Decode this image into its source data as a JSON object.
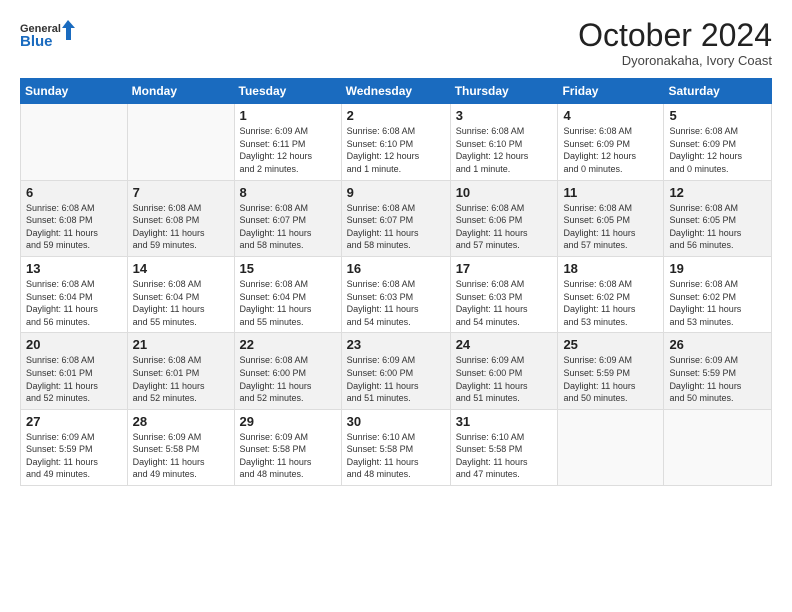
{
  "header": {
    "logo_general": "General",
    "logo_blue": "Blue",
    "month": "October 2024",
    "location": "Dyoronakaha, Ivory Coast"
  },
  "weekdays": [
    "Sunday",
    "Monday",
    "Tuesday",
    "Wednesday",
    "Thursday",
    "Friday",
    "Saturday"
  ],
  "weeks": [
    [
      {
        "day": "",
        "info": ""
      },
      {
        "day": "",
        "info": ""
      },
      {
        "day": "1",
        "info": "Sunrise: 6:09 AM\nSunset: 6:11 PM\nDaylight: 12 hours\nand 2 minutes."
      },
      {
        "day": "2",
        "info": "Sunrise: 6:08 AM\nSunset: 6:10 PM\nDaylight: 12 hours\nand 1 minute."
      },
      {
        "day": "3",
        "info": "Sunrise: 6:08 AM\nSunset: 6:10 PM\nDaylight: 12 hours\nand 1 minute."
      },
      {
        "day": "4",
        "info": "Sunrise: 6:08 AM\nSunset: 6:09 PM\nDaylight: 12 hours\nand 0 minutes."
      },
      {
        "day": "5",
        "info": "Sunrise: 6:08 AM\nSunset: 6:09 PM\nDaylight: 12 hours\nand 0 minutes."
      }
    ],
    [
      {
        "day": "6",
        "info": "Sunrise: 6:08 AM\nSunset: 6:08 PM\nDaylight: 11 hours\nand 59 minutes."
      },
      {
        "day": "7",
        "info": "Sunrise: 6:08 AM\nSunset: 6:08 PM\nDaylight: 11 hours\nand 59 minutes."
      },
      {
        "day": "8",
        "info": "Sunrise: 6:08 AM\nSunset: 6:07 PM\nDaylight: 11 hours\nand 58 minutes."
      },
      {
        "day": "9",
        "info": "Sunrise: 6:08 AM\nSunset: 6:07 PM\nDaylight: 11 hours\nand 58 minutes."
      },
      {
        "day": "10",
        "info": "Sunrise: 6:08 AM\nSunset: 6:06 PM\nDaylight: 11 hours\nand 57 minutes."
      },
      {
        "day": "11",
        "info": "Sunrise: 6:08 AM\nSunset: 6:05 PM\nDaylight: 11 hours\nand 57 minutes."
      },
      {
        "day": "12",
        "info": "Sunrise: 6:08 AM\nSunset: 6:05 PM\nDaylight: 11 hours\nand 56 minutes."
      }
    ],
    [
      {
        "day": "13",
        "info": "Sunrise: 6:08 AM\nSunset: 6:04 PM\nDaylight: 11 hours\nand 56 minutes."
      },
      {
        "day": "14",
        "info": "Sunrise: 6:08 AM\nSunset: 6:04 PM\nDaylight: 11 hours\nand 55 minutes."
      },
      {
        "day": "15",
        "info": "Sunrise: 6:08 AM\nSunset: 6:04 PM\nDaylight: 11 hours\nand 55 minutes."
      },
      {
        "day": "16",
        "info": "Sunrise: 6:08 AM\nSunset: 6:03 PM\nDaylight: 11 hours\nand 54 minutes."
      },
      {
        "day": "17",
        "info": "Sunrise: 6:08 AM\nSunset: 6:03 PM\nDaylight: 11 hours\nand 54 minutes."
      },
      {
        "day": "18",
        "info": "Sunrise: 6:08 AM\nSunset: 6:02 PM\nDaylight: 11 hours\nand 53 minutes."
      },
      {
        "day": "19",
        "info": "Sunrise: 6:08 AM\nSunset: 6:02 PM\nDaylight: 11 hours\nand 53 minutes."
      }
    ],
    [
      {
        "day": "20",
        "info": "Sunrise: 6:08 AM\nSunset: 6:01 PM\nDaylight: 11 hours\nand 52 minutes."
      },
      {
        "day": "21",
        "info": "Sunrise: 6:08 AM\nSunset: 6:01 PM\nDaylight: 11 hours\nand 52 minutes."
      },
      {
        "day": "22",
        "info": "Sunrise: 6:08 AM\nSunset: 6:00 PM\nDaylight: 11 hours\nand 52 minutes."
      },
      {
        "day": "23",
        "info": "Sunrise: 6:09 AM\nSunset: 6:00 PM\nDaylight: 11 hours\nand 51 minutes."
      },
      {
        "day": "24",
        "info": "Sunrise: 6:09 AM\nSunset: 6:00 PM\nDaylight: 11 hours\nand 51 minutes."
      },
      {
        "day": "25",
        "info": "Sunrise: 6:09 AM\nSunset: 5:59 PM\nDaylight: 11 hours\nand 50 minutes."
      },
      {
        "day": "26",
        "info": "Sunrise: 6:09 AM\nSunset: 5:59 PM\nDaylight: 11 hours\nand 50 minutes."
      }
    ],
    [
      {
        "day": "27",
        "info": "Sunrise: 6:09 AM\nSunset: 5:59 PM\nDaylight: 11 hours\nand 49 minutes."
      },
      {
        "day": "28",
        "info": "Sunrise: 6:09 AM\nSunset: 5:58 PM\nDaylight: 11 hours\nand 49 minutes."
      },
      {
        "day": "29",
        "info": "Sunrise: 6:09 AM\nSunset: 5:58 PM\nDaylight: 11 hours\nand 48 minutes."
      },
      {
        "day": "30",
        "info": "Sunrise: 6:10 AM\nSunset: 5:58 PM\nDaylight: 11 hours\nand 48 minutes."
      },
      {
        "day": "31",
        "info": "Sunrise: 6:10 AM\nSunset: 5:58 PM\nDaylight: 11 hours\nand 47 minutes."
      },
      {
        "day": "",
        "info": ""
      },
      {
        "day": "",
        "info": ""
      }
    ]
  ]
}
